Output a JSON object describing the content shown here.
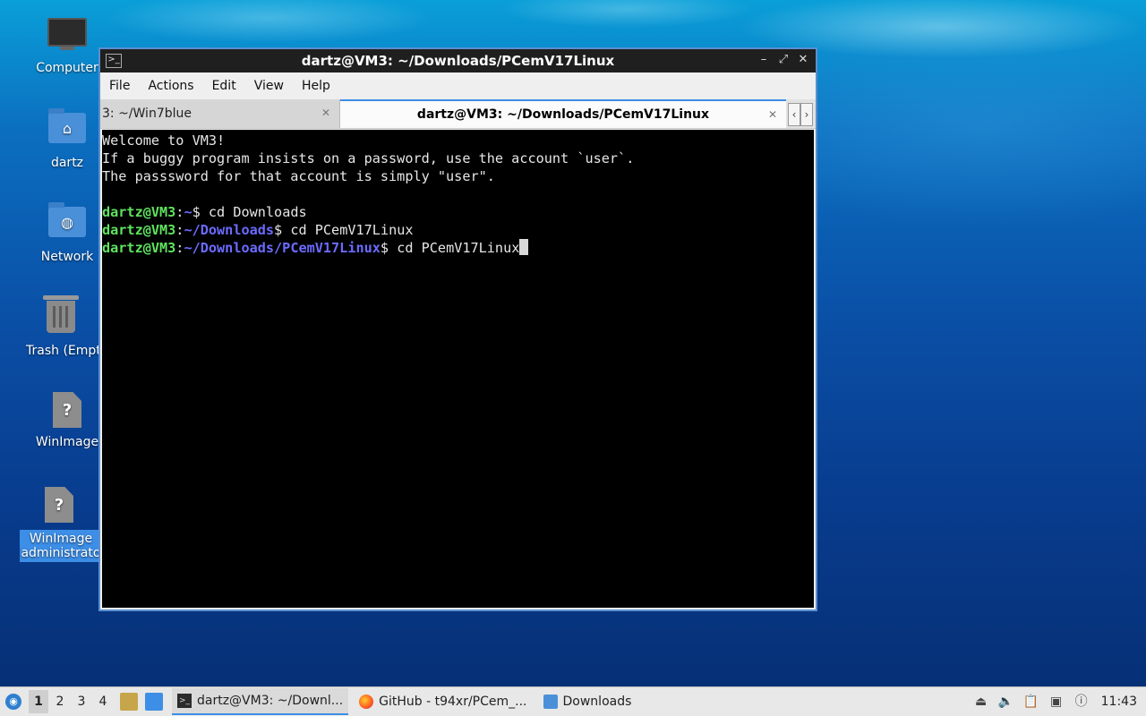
{
  "desktop": {
    "icons": [
      {
        "label": "Computer"
      },
      {
        "label": "dartz"
      },
      {
        "label": "Network"
      },
      {
        "label": "Trash (Empty)"
      },
      {
        "label": "WinImage"
      },
      {
        "label": "WinImage (administrator)"
      }
    ]
  },
  "window": {
    "title": "dartz@VM3: ~/Downloads/PCemV17Linux",
    "menu": [
      "File",
      "Actions",
      "Edit",
      "View",
      "Help"
    ],
    "tabs": [
      {
        "label": "3: ~/Win7blue"
      },
      {
        "label": "dartz@VM3: ~/Downloads/PCemV17Linux"
      }
    ],
    "terminal": {
      "welcome": [
        "Welcome to VM3!",
        "If a buggy program insists on a password, use the account `user`.",
        "The passsword for that account is simply \"user\"."
      ],
      "prompts": [
        {
          "user": "dartz@VM3",
          "path": "~",
          "command": "cd Downloads"
        },
        {
          "user": "dartz@VM3",
          "path": "~/Downloads",
          "command": "cd PCemV17Linux"
        },
        {
          "user": "dartz@VM3",
          "path": "~/Downloads/PCemV17Linux",
          "command": "cd PCemV17Linux"
        }
      ]
    }
  },
  "taskbar": {
    "workspaces": [
      "1",
      "2",
      "3",
      "4"
    ],
    "tasks": [
      {
        "label": "dartz@VM3: ~/Downl..."
      },
      {
        "label": "GitHub - t94xr/PCem_..."
      },
      {
        "label": "Downloads"
      }
    ],
    "clock": "11:43"
  }
}
